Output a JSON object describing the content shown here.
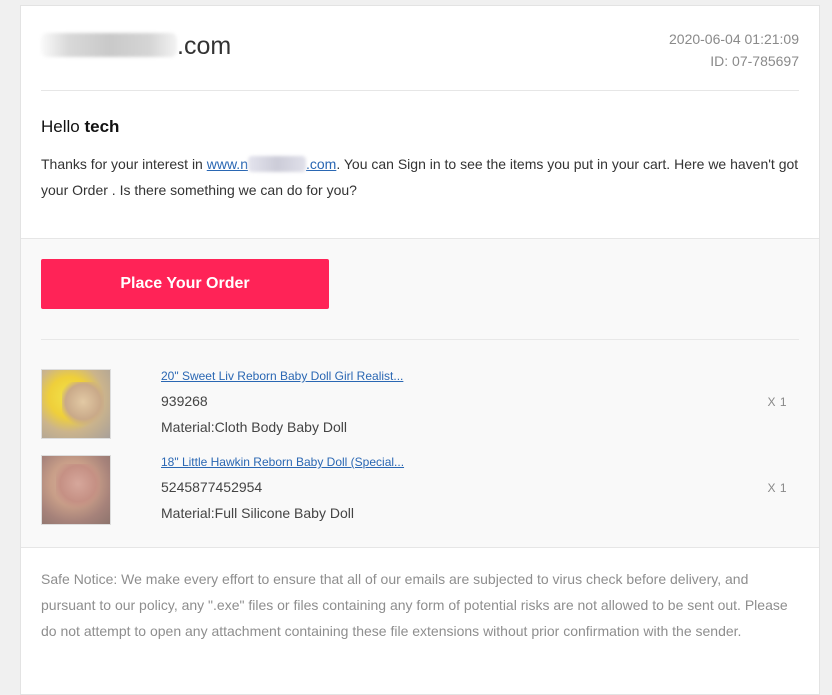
{
  "header": {
    "logo_suffix": ".com",
    "timestamp": "2020-06-04 01:21:09",
    "id_text": "ID: 07-785697"
  },
  "greeting": {
    "prefix": "Hello",
    "name": "tech"
  },
  "message": {
    "part1": "Thanks for your interest in ",
    "link_prefix": "www.n",
    "link_suffix": ".com",
    "part2": ". You can Sign in to see the items you put in your cart. Here we haven't got your Order . Is there something we can do for you?"
  },
  "order": {
    "button_label": "Place Your Order",
    "items": [
      {
        "title": "20\" Sweet Liv Reborn Baby Doll Girl Realist...",
        "sku": "939268",
        "material": "Material:Cloth Body Baby Doll",
        "qty": "X 1"
      },
      {
        "title": "18\" Little Hawkin Reborn Baby Doll (Special...",
        "sku": "5245877452954",
        "material": "Material:Full Silicone Baby Doll",
        "qty": "X 1"
      }
    ]
  },
  "notice": {
    "text": "Safe Notice: We make every effort to ensure that all of our emails are subjected to virus check before delivery, and pursuant to our policy, any \".exe\" files or files containing any form of potential risks are not allowed to be sent out. Please do not attempt to open any attachment containing these file extensions without prior confirmation with the sender."
  },
  "colors": {
    "accent": "#ff2357",
    "link": "#2a67b3"
  }
}
